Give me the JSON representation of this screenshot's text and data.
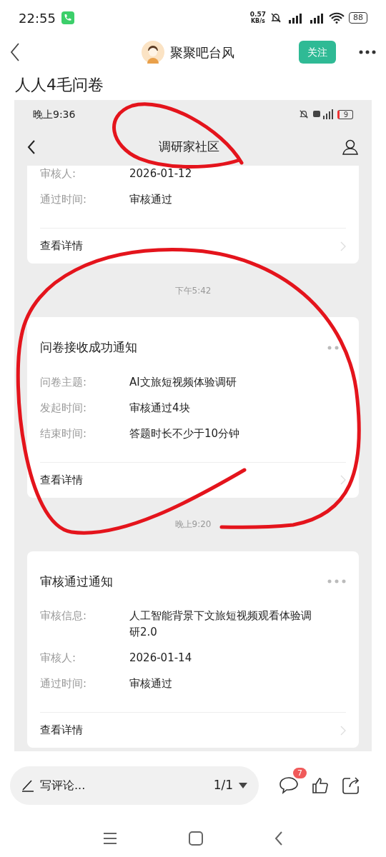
{
  "status_bar": {
    "time": "22:55",
    "speed": "0.57",
    "speed_unit": "KB/s",
    "battery": "88"
  },
  "header": {
    "author": "聚聚吧台风",
    "follow": "关注"
  },
  "post_title": "人人4毛问卷",
  "screenshot": {
    "status_bar": {
      "time": "晚上9:36",
      "battery": "9"
    },
    "nav_title": "调研家社区",
    "feed": [
      {
        "kind": "card",
        "clipped": true,
        "fields": [
          {
            "label": "审核人:",
            "value": "2026-01-12"
          },
          {
            "label": "通过时间:",
            "value": "审核通过"
          }
        ],
        "link": "查看详情"
      },
      {
        "kind": "time",
        "text": "下午5:42"
      },
      {
        "kind": "card",
        "clipped": false,
        "title": "问卷接收成功通知",
        "fields": [
          {
            "label": "问卷主题:",
            "value": "AI文旅短视频体验调研"
          },
          {
            "label": "发起时间:",
            "value": "审核通过4块"
          },
          {
            "label": "结束时间:",
            "value": "答题时长不少于10分钟"
          }
        ],
        "link": "查看详情"
      },
      {
        "kind": "time",
        "text": "晚上9:20"
      },
      {
        "kind": "card",
        "clipped": false,
        "title": "审核通过通知",
        "fields": [
          {
            "label": "审核信息:",
            "value": "人工智能背景下文旅短视频观看体验调研2.0"
          },
          {
            "label": "审核人:",
            "value": "2026-01-14"
          },
          {
            "label": "通过时间:",
            "value": "审核通过"
          }
        ],
        "link": "查看详情"
      }
    ]
  },
  "bottom_bar": {
    "comment_placeholder": "写评论...",
    "pages": "1/1",
    "comment_count": "7"
  }
}
